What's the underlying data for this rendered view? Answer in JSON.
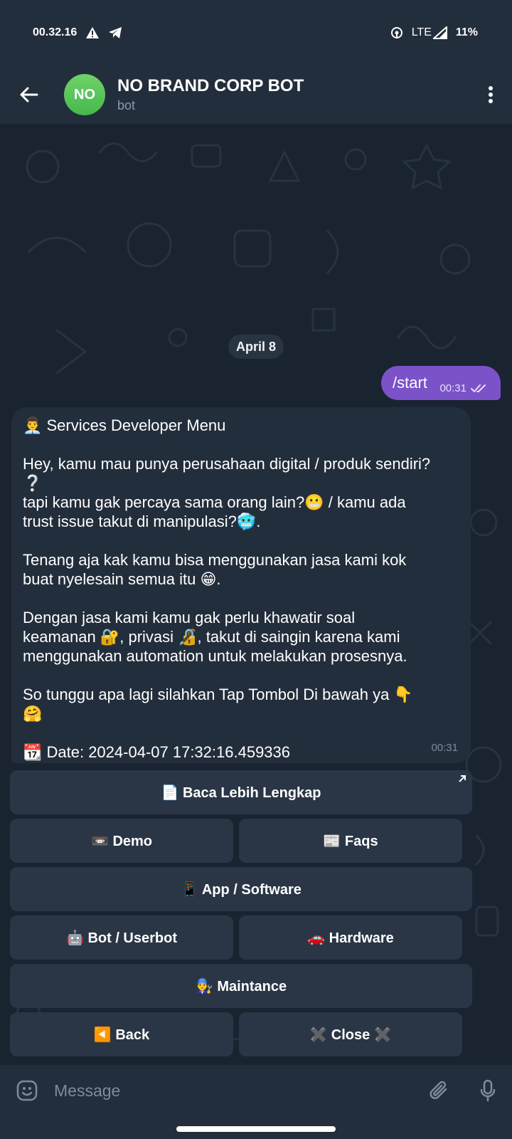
{
  "status_bar": {
    "time": "00.32.16",
    "network": "LTE",
    "battery": "11%"
  },
  "header": {
    "avatar_initials": "NO",
    "title": "NO BRAND CORP BOT",
    "subtitle": "bot"
  },
  "chat": {
    "date_chip": "April 8",
    "outgoing": {
      "text": "/start",
      "time": "00:31"
    },
    "incoming": {
      "lines": [
        "👨‍💼 Services Developer Menu",
        "",
        "Hey, kamu mau punya perusahaan digital / produk sendiri?",
        "❔",
        "tapi kamu gak percaya sama orang lain?😬 / kamu ada",
        "trust issue takut di manipulasi?🥶.",
        "",
        "Tenang aja kak kamu bisa menggunakan jasa kami kok",
        "buat nyelesain semua itu 😁.",
        "",
        "Dengan jasa kami kamu gak perlu khawatir soal",
        "keamanan 🔐, privasi 🔏, takut di saingin karena kami",
        "menggunakan automation untuk melakukan prosesnya.",
        "",
        "So tunggu apa lagi silahkan Tap Tombol Di bawah ya 👇",
        "🤗",
        "",
        "📆 Date: 2024-04-07 17:32:16.459336"
      ],
      "time": "00:31"
    }
  },
  "keyboard": {
    "read_more": "📄 Baca Lebih Lengkap",
    "demo": "📼 Demo",
    "faqs": "📰 Faqs",
    "app_software": "📱 App / Software",
    "bot_userbot": "🤖 Bot / Userbot",
    "hardware": "🚗 Hardware",
    "maintance": "👨‍🔧 Maintance",
    "back": "◀️ Back",
    "close": "✖️ Close ✖️"
  },
  "input": {
    "placeholder": "Message"
  },
  "colors": {
    "header_bg": "#232e3c",
    "chat_bg": "#1a2330",
    "outgoing_bubble": "#7b52c8",
    "incoming_bubble": "#232e3c",
    "keyboard_button": "#2a3646",
    "avatar_green": "#53c257"
  }
}
